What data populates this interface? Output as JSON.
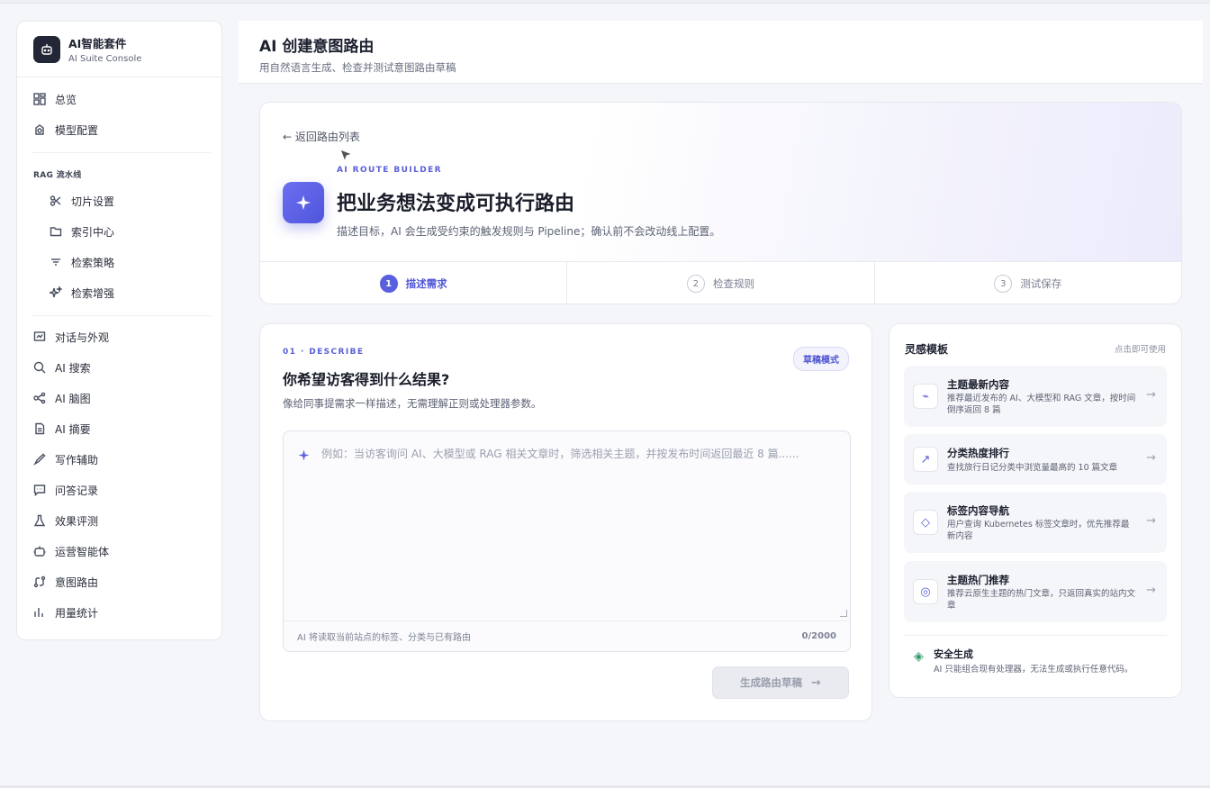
{
  "brand": {
    "title": "AI智能套件",
    "subtitle": "AI Suite Console"
  },
  "sidebar": {
    "items_top": [
      {
        "label": "总览",
        "icon": "dashboard-icon"
      },
      {
        "label": "模型配置",
        "icon": "model-icon"
      }
    ],
    "rag_group_label": "RAG 流水线",
    "rag_items": [
      {
        "label": "切片设置",
        "icon": "scissors-icon"
      },
      {
        "label": "索引中心",
        "icon": "folder-icon"
      },
      {
        "label": "检索策略",
        "icon": "filter-icon"
      },
      {
        "label": "检索增强",
        "icon": "sparkles-icon"
      }
    ],
    "items_bottom": [
      {
        "label": "对话与外观",
        "icon": "chat-icon"
      },
      {
        "label": "AI 搜索",
        "icon": "search-icon"
      },
      {
        "label": "AI 脑图",
        "icon": "mindmap-icon"
      },
      {
        "label": "AI 摘要",
        "icon": "document-icon"
      },
      {
        "label": "写作辅助",
        "icon": "pen-icon"
      },
      {
        "label": "问答记录",
        "icon": "message-icon"
      },
      {
        "label": "效果评测",
        "icon": "flask-icon"
      },
      {
        "label": "运营智能体",
        "icon": "robot-icon"
      },
      {
        "label": "意图路由",
        "icon": "route-icon"
      },
      {
        "label": "用量统计",
        "icon": "bar-chart-icon"
      }
    ]
  },
  "header": {
    "title": "AI 创建意图路由",
    "subtitle": "用自然语言生成、检查并测试意图路由草稿"
  },
  "hero": {
    "back_label": "← 返回路由列表",
    "badge": "AI ROUTE BUILDER",
    "title": "把业务想法变成可执行路由",
    "description": "描述目标，AI 会生成受约束的触发规则与 Pipeline；确认前不会改动线上配置。",
    "steps": [
      {
        "num": "1",
        "label": "描述需求",
        "active": true
      },
      {
        "num": "2",
        "label": "检查规则",
        "active": false
      },
      {
        "num": "3",
        "label": "测试保存",
        "active": false
      }
    ]
  },
  "describe": {
    "section_tag": "01 · DESCRIBE",
    "draft_badge": "草稿模式",
    "title": "你希望访客得到什么结果?",
    "subtitle": "像给同事提需求一样描述，无需理解正则或处理器参数。",
    "placeholder": "例如：当访客询问 AI、大模型或 RAG 相关文章时，筛选相关主题，并按发布时间返回最近 8 篇......",
    "footer_note": "AI 将读取当前站点的标签、分类与已有路由",
    "char_count": "0/2000",
    "generate_label": "生成路由草稿"
  },
  "templates": {
    "title": "灵感模板",
    "hint": "点击即可使用",
    "items": [
      {
        "name": "主题最新内容",
        "desc": "推荐最近发布的 AI、大模型和 RAG 文章，按时间倒序返回 8 篇",
        "icon": "⌁"
      },
      {
        "name": "分类热度排行",
        "desc": "查找旅行日记分类中浏览量最高的 10 篇文章",
        "icon": "↗"
      },
      {
        "name": "标签内容导航",
        "desc": "用户查询 Kubernetes 标签文章时，优先推荐最新内容",
        "icon": "◇"
      },
      {
        "name": "主题热门推荐",
        "desc": "推荐云原生主题的热门文章，只返回真实的站内文章",
        "icon": "◎"
      }
    ],
    "safe_title": "安全生成",
    "safe_desc": "AI 只能组合现有处理器，无法生成或执行任意代码。"
  },
  "colors": {
    "accent": "#5a5fe0",
    "safe": "#2f9a6a"
  }
}
